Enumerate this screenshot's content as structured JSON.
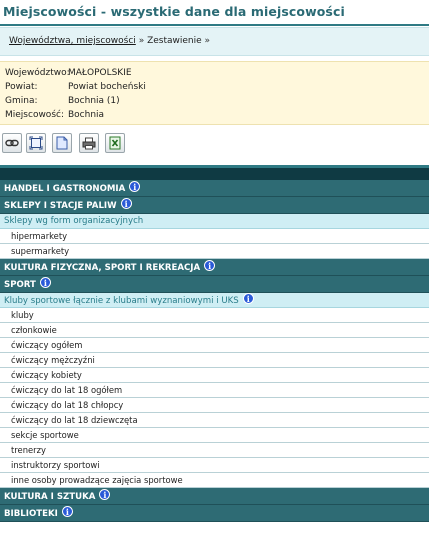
{
  "page": {
    "title": "Miejscowości - wszystkie dane dla miejscowości"
  },
  "breadcrumb": {
    "link": "Województwa, miejscowości",
    "sep1": "»",
    "current": "Zestawienie",
    "sep2": "»"
  },
  "location": [
    {
      "label": "Województwo:",
      "value": "MAŁOPOLSKIE"
    },
    {
      "label": "Powiat:",
      "value": "Powiat bocheński"
    },
    {
      "label": "Gmina:",
      "value": "Bochnia (1)"
    },
    {
      "label": "Miejscowość:",
      "value": "Bochnia"
    }
  ],
  "toolbar": {
    "icons": [
      "link-icon",
      "expand-icon",
      "document-icon",
      "print-icon",
      "excel-icon"
    ]
  },
  "info_glyph": "i",
  "table": {
    "rows": [
      {
        "kind": "category",
        "text": "HANDEL I GASTRONOMIA",
        "info": true
      },
      {
        "kind": "category",
        "text": "SKLEPY I STACJE PALIW",
        "info": true
      },
      {
        "kind": "sub",
        "text": "Sklepy wg form organizacyjnych"
      },
      {
        "kind": "item",
        "text": "hipermarkety"
      },
      {
        "kind": "item",
        "text": "supermarkety"
      },
      {
        "kind": "category",
        "text": "KULTURA FIZYCZNA, SPORT I REKREACJA",
        "info": true
      },
      {
        "kind": "category",
        "text": "SPORT",
        "info": true
      },
      {
        "kind": "sub",
        "text": "Kluby sportowe łącznie z klubami wyznaniowymi i UKS",
        "info": true
      },
      {
        "kind": "item",
        "text": "kluby"
      },
      {
        "kind": "item",
        "text": "członkowie"
      },
      {
        "kind": "item",
        "text": "ćwiczący ogółem"
      },
      {
        "kind": "item",
        "text": "ćwiczący mężczyźni"
      },
      {
        "kind": "item",
        "text": "ćwiczący kobiety"
      },
      {
        "kind": "item",
        "text": "ćwiczący do lat 18 ogółem"
      },
      {
        "kind": "item",
        "text": "ćwiczący do lat 18 chłopcy"
      },
      {
        "kind": "item",
        "text": "ćwiczący do lat 18 dziewczęta"
      },
      {
        "kind": "item",
        "text": "sekcje sportowe"
      },
      {
        "kind": "item",
        "text": "trenerzy"
      },
      {
        "kind": "item",
        "text": "instruktorzy sportowi"
      },
      {
        "kind": "item",
        "text": "inne osoby prowadzące zajęcia sportowe"
      },
      {
        "kind": "category",
        "text": "KULTURA I SZTUKA",
        "info": true
      },
      {
        "kind": "category",
        "text": "BIBLIOTEKI",
        "info": true
      }
    ]
  }
}
